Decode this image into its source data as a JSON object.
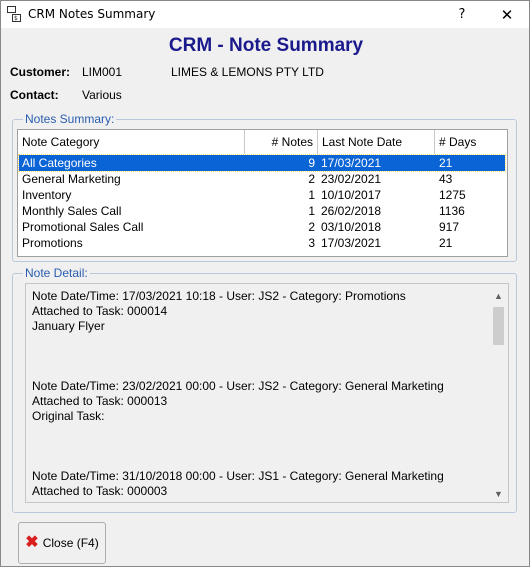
{
  "window": {
    "title": "CRM Notes Summary",
    "help_glyph": "?",
    "close_glyph": "✕"
  },
  "heading": "CRM - Note Summary",
  "customer": {
    "label": "Customer:",
    "code": "LIM001",
    "name": "LIMES & LEMONS PTY LTD"
  },
  "contact": {
    "label": "Contact:",
    "value": "Various"
  },
  "notes_summary": {
    "legend": "Notes Summary:",
    "columns": [
      "Note Category",
      "# Notes",
      "Last Note Date",
      "# Days"
    ],
    "rows": [
      {
        "category": "All Categories",
        "notes": "9",
        "last_date": "17/03/2021",
        "days": "21",
        "selected": true
      },
      {
        "category": "General Marketing",
        "notes": "2",
        "last_date": "23/02/2021",
        "days": "43"
      },
      {
        "category": "Inventory",
        "notes": "1",
        "last_date": "10/10/2017",
        "days": "1275"
      },
      {
        "category": "Monthly Sales Call",
        "notes": "1",
        "last_date": "26/02/2018",
        "days": "1136"
      },
      {
        "category": "Promotional Sales Call",
        "notes": "2",
        "last_date": "03/10/2018",
        "days": "917"
      },
      {
        "category": "Promotions",
        "notes": "3",
        "last_date": "17/03/2021",
        "days": "21"
      }
    ]
  },
  "note_detail": {
    "legend": "Note Detail:",
    "text": "Note Date/Time: 17/03/2021 10:18 - User: JS2 - Category: Promotions\nAttached to Task: 000014\nJanuary Flyer\n\n\n\nNote Date/Time: 23/02/2021 00:00 - User: JS2 - Category: General Marketing\nAttached to Task: 000013\nOriginal Task:\n\n\n\nNote Date/Time: 31/10/2018 00:00 - User: JS1 - Category: General Marketing\nAttached to Task: 000003"
  },
  "close_button": {
    "label": "Close (F4)"
  },
  "colors": {
    "heading": "#1a1a8c",
    "legend": "#2a5db0",
    "selection": "#0a64d6",
    "close_icon": "#d91e1e"
  }
}
